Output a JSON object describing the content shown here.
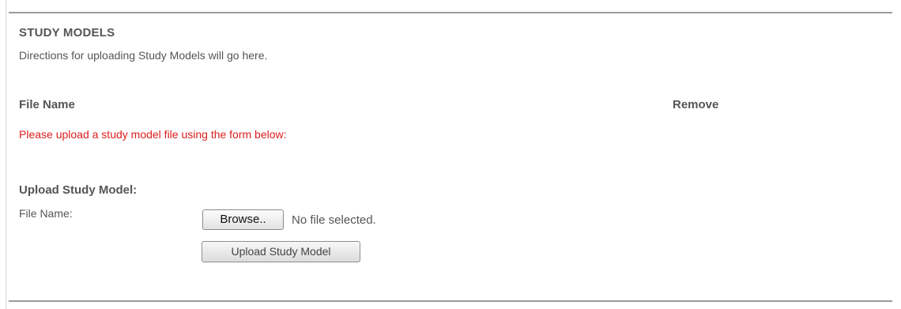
{
  "section": {
    "title": "STUDY MODELS",
    "directions": "Directions for uploading Study Models will go here."
  },
  "file_table": {
    "columns": [
      "File Name",
      "Remove"
    ],
    "empty_message": "Please upload a study model file using the form below:"
  },
  "upload_form": {
    "heading": "Upload Study Model:",
    "file_label": "File Name:",
    "browse_label": "Browse..",
    "file_status": "No file selected.",
    "submit_label": "Upload Study Model"
  },
  "colors": {
    "text": "#555555",
    "error": "#dd1c1c",
    "rule": "#9a9a9a"
  }
}
